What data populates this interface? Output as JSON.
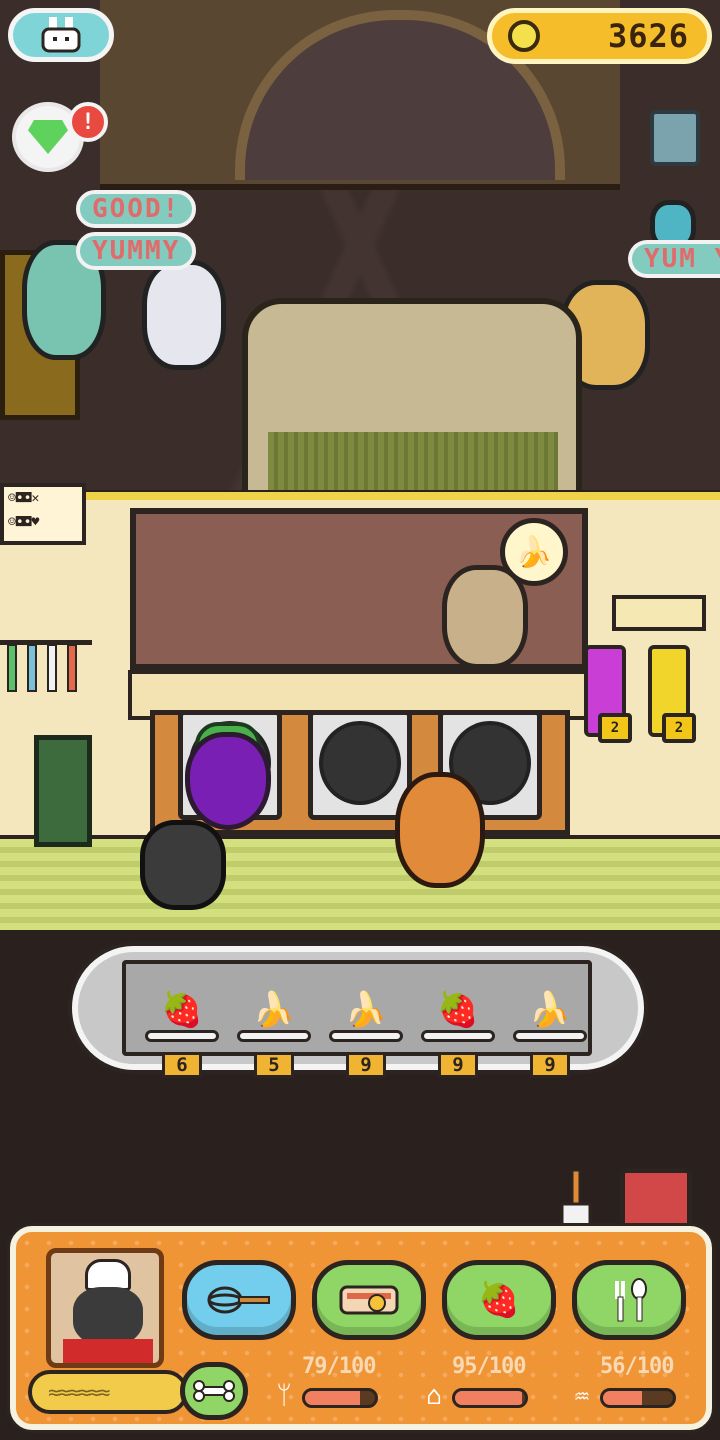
{
  "hud": {
    "coins": "3626",
    "notification_count": "!"
  },
  "speech": {
    "good": "GOOD!",
    "yummy": "YUMMY",
    "yum_partial": "YUM Y"
  },
  "note_card": {
    "line1": "☺◘◘✕",
    "line2": "☺◘◘♥"
  },
  "customer_request": "banana",
  "locks": [
    "2",
    "2"
  ],
  "order_tray": {
    "items": [
      {
        "fruit": "strawberry",
        "icon": "🍓",
        "count": "6"
      },
      {
        "fruit": "banana",
        "icon": "🍌",
        "count": "5"
      },
      {
        "fruit": "banana",
        "icon": "🍌",
        "count": "9"
      },
      {
        "fruit": "strawberry",
        "icon": "🍓",
        "count": "9"
      },
      {
        "fruit": "banana",
        "icon": "🍌",
        "count": "9"
      }
    ]
  },
  "panel": {
    "actions": [
      {
        "name": "whisk",
        "icon": "whisk-icon",
        "glyph": "⌁"
      },
      {
        "name": "bacon",
        "icon": "bacon-icon",
        "glyph": "▬"
      },
      {
        "name": "fruit",
        "icon": "fruit-icon",
        "glyph": "🍓"
      },
      {
        "name": "utensils",
        "icon": "utensils-icon",
        "glyph": "⚲"
      }
    ],
    "stats": [
      {
        "name": "food",
        "icon": "fork-spoon-icon",
        "glyph": "ᛘ",
        "text": "79/100",
        "value": 79
      },
      {
        "name": "rest",
        "icon": "bed-icon",
        "glyph": "⌂",
        "text": "95/100",
        "value": 95
      },
      {
        "name": "clean",
        "icon": "shower-icon",
        "glyph": "♒",
        "text": "56/100",
        "value": 56
      }
    ],
    "rank": "≈≈≈≈≈≈"
  },
  "colors": {
    "accent_orange": "#ef9536",
    "coin_gold": "#f6bd2b",
    "kitchen_yellow": "#efd44a",
    "button_blue": "#73cdec",
    "button_green": "#8fd666"
  }
}
